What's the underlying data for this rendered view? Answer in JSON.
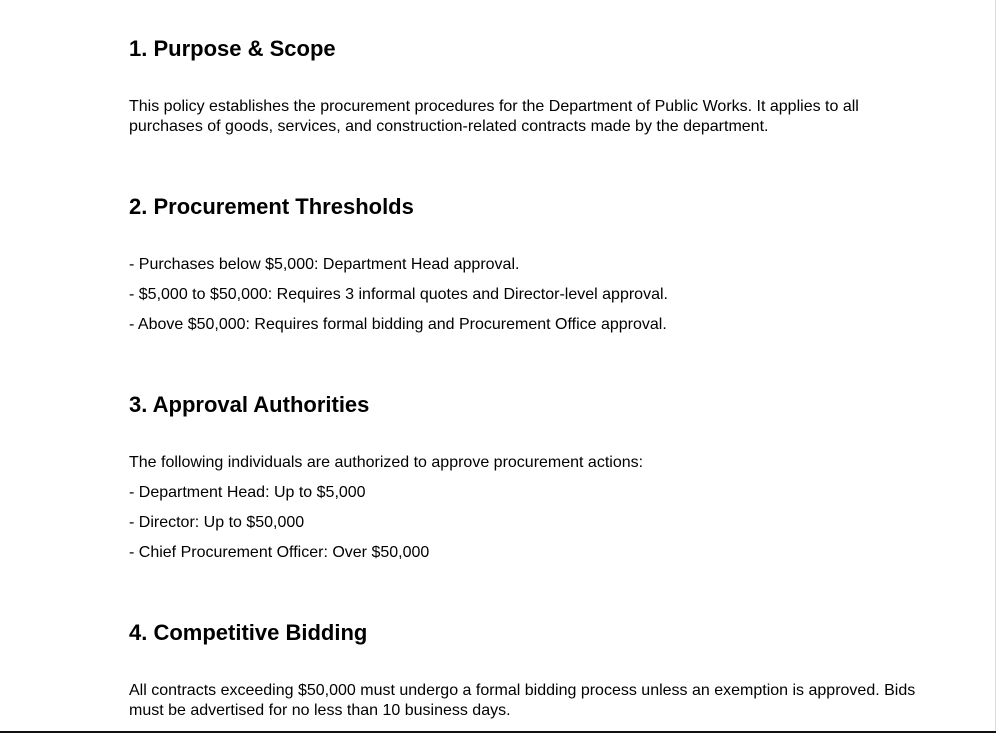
{
  "sections": [
    {
      "heading": "1. Purpose & Scope",
      "body": "This policy establishes the procurement procedures for the Department of Public Works. It applies to all purchases of goods, services, and construction-related contracts made by the department."
    },
    {
      "heading": "2. Procurement Thresholds",
      "items": [
        "- Purchases below $5,000: Department Head approval.",
        "- $5,000 to $50,000: Requires 3 informal quotes and Director-level approval.",
        "- Above $50,000: Requires formal bidding and Procurement Office approval."
      ]
    },
    {
      "heading": "3. Approval Authorities",
      "lead": "The following individuals are authorized to approve procurement actions:",
      "items": [
        "- Department Head: Up to $5,000",
        "- Director: Up to $50,000",
        "- Chief Procurement Officer: Over $50,000"
      ]
    },
    {
      "heading": "4. Competitive Bidding",
      "body": "All contracts exceeding $50,000 must undergo a formal bidding process unless an exemption is approved. Bids must be advertised for no less than 10 business days."
    }
  ]
}
